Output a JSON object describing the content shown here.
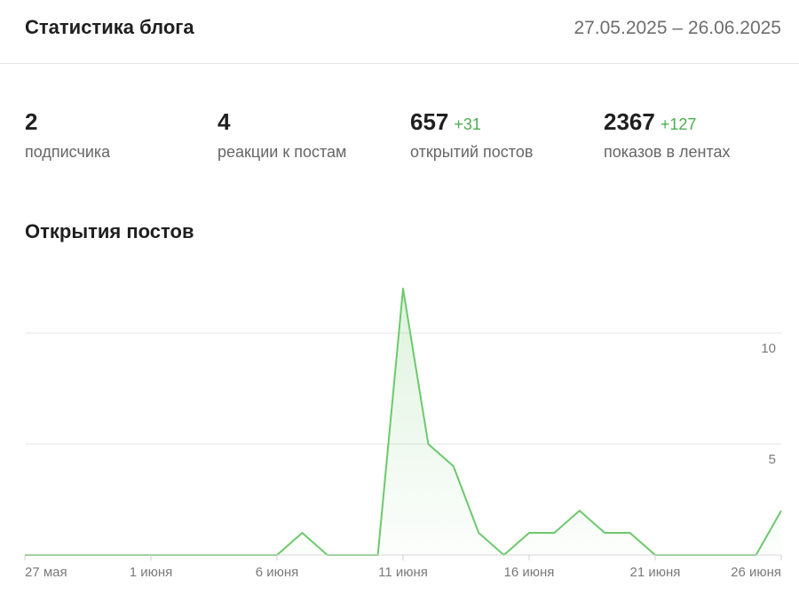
{
  "header": {
    "title": "Статистика блога",
    "date_range": "27.05.2025 – 26.06.2025"
  },
  "stats": [
    {
      "value": "2",
      "delta": "",
      "label": "подписчика"
    },
    {
      "value": "4",
      "delta": "",
      "label": "реакции к постам"
    },
    {
      "value": "657",
      "delta": "+31",
      "label": "открытий постов"
    },
    {
      "value": "2367",
      "delta": "+127",
      "label": "показов в лентах"
    }
  ],
  "chart_section": {
    "title": "Открытия постов"
  },
  "colors": {
    "line": "#6cc96c",
    "positive_delta": "#4caf50",
    "grid": "#e4e4e4"
  },
  "chart_data": {
    "type": "area",
    "x": [
      "27 мая",
      "28 мая",
      "29 мая",
      "30 мая",
      "31 мая",
      "1 июня",
      "2 июня",
      "3 июня",
      "4 июня",
      "5 июня",
      "6 июня",
      "7 июня",
      "8 июня",
      "9 июня",
      "10 июня",
      "11 июня",
      "12 июня",
      "13 июня",
      "14 июня",
      "15 июня",
      "16 июня",
      "17 июня",
      "18 июня",
      "19 июня",
      "20 июня",
      "21 июня",
      "22 июня",
      "23 июня",
      "24 июня",
      "25 июня",
      "26 июня"
    ],
    "series": [
      {
        "values": [
          0,
          0,
          0,
          0,
          0,
          0,
          0,
          0,
          0,
          0,
          0,
          1,
          0,
          0,
          0,
          12,
          5,
          4,
          1,
          0,
          1,
          1,
          2,
          1,
          1,
          0,
          0,
          0,
          0,
          0,
          2
        ]
      }
    ],
    "x_tick_labels": [
      "27 мая",
      "1 июня",
      "6 июня",
      "11 июня",
      "16 июня",
      "21 июня",
      "26 июня"
    ],
    "y_tick_labels": [
      "5",
      "10"
    ],
    "yticks": [
      5,
      10
    ],
    "ylim": [
      0,
      12.5
    ],
    "grid": true,
    "y_axis_position": "right",
    "title": "",
    "xlabel": "",
    "ylabel": ""
  }
}
